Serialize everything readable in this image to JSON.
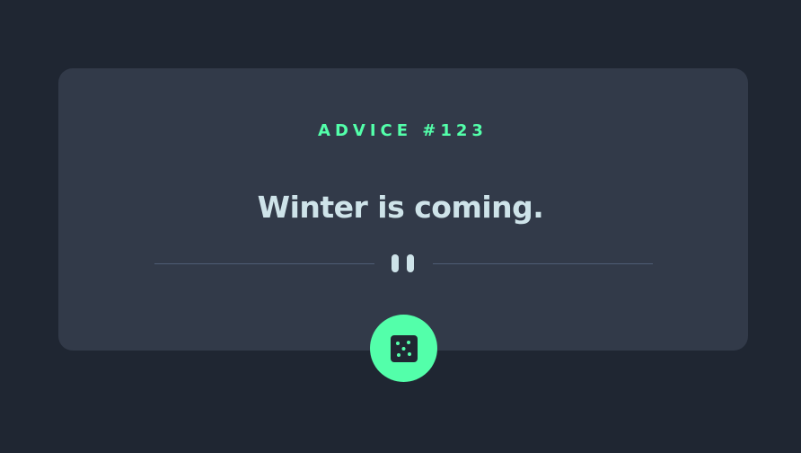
{
  "advice": {
    "label": "ADVICE #123",
    "text": "Winter is coming."
  },
  "icons": {
    "divider": "pause-divider-icon",
    "dice": "dice-icon"
  },
  "colors": {
    "background": "#1f2632",
    "card": "#323a49",
    "accent": "#53ffaa",
    "text": "#cee3e9",
    "divider_line": "#4f5d74"
  }
}
